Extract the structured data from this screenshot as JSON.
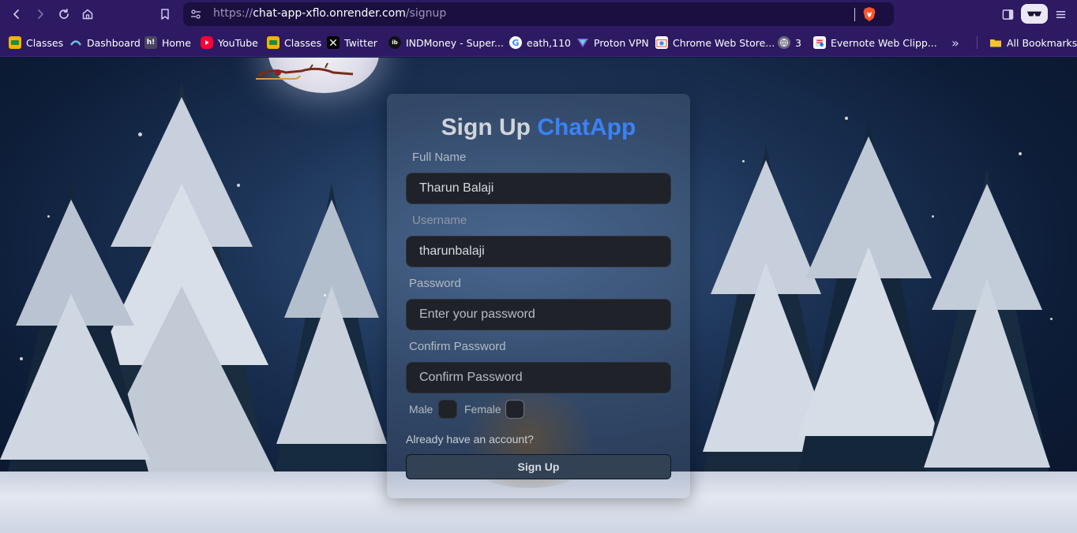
{
  "browser": {
    "url_prefix": "https://",
    "url_host": "chat-app-xflo.onrender.com",
    "url_path": "/signup",
    "bookmarks": [
      {
        "label": "Classes",
        "icon": "classroom-icon"
      },
      {
        "label": "Dashboard",
        "icon": "dashboard-icon"
      },
      {
        "label": "Home",
        "icon": "hackerrank-icon"
      },
      {
        "label": "YouTube",
        "icon": "youtube-icon"
      },
      {
        "label": "Classes",
        "icon": "classroom-icon"
      },
      {
        "label": "Twitter",
        "icon": "x-icon"
      },
      {
        "label": "INDMoney - Super...",
        "icon": "indmoney-icon"
      },
      {
        "label": "eath,110",
        "icon": "google-icon"
      },
      {
        "label": "Proton VPN",
        "icon": "proton-vpn-icon"
      },
      {
        "label": "Chrome Web Store...",
        "icon": "chrome-web-store-icon"
      },
      {
        "label": "3",
        "icon": "globe-icon"
      },
      {
        "label": "Evernote Web Clipp...",
        "icon": "evernote-icon"
      }
    ],
    "more_label": "»",
    "all_bookmarks_label": "All Bookmarks"
  },
  "signup": {
    "title_main": "Sign Up ",
    "title_accent": "ChatApp",
    "full_name_label": "Full Name",
    "full_name_value": "Tharun Balaji",
    "username_label": "Username",
    "username_value": "tharunbalaji",
    "password_label": "Password",
    "password_placeholder": "Enter your password",
    "confirm_label": "Confirm Password",
    "confirm_placeholder": "Confirm Password",
    "male_label": "Male",
    "female_label": "Female",
    "login_link": "Already have an account?",
    "submit_label": "Sign Up"
  },
  "colors": {
    "browser_bg": "#2d1a63",
    "accent": "#3b82f6",
    "input_bg": "#1f2329",
    "button_bg": "#334155"
  }
}
